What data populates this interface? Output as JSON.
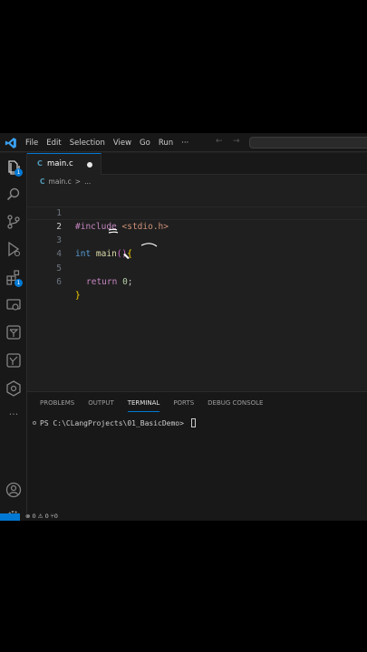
{
  "menu": [
    "File",
    "Edit",
    "Selection",
    "View",
    "Go",
    "Run",
    "···"
  ],
  "tabs": [
    {
      "icon": "C",
      "label": "main.c",
      "modified": true
    }
  ],
  "breadcrumb": {
    "icon": "C",
    "file": "main.c",
    "sep": ">",
    "more": "..."
  },
  "editor": {
    "lines": [
      {
        "num": "1"
      },
      {
        "num": "2"
      },
      {
        "num": "3"
      },
      {
        "num": "4"
      },
      {
        "num": "5"
      },
      {
        "num": "6"
      }
    ],
    "include_kw": "#include",
    "include_hdr": "<stdio.h>",
    "int_kw": "int",
    "main_fn": "main",
    "open_paren": "(",
    "close_paren": ")",
    "open_brace": "{",
    "return_kw": "return",
    "zero": "0",
    "semi": ";",
    "close_brace": "}"
  },
  "activity_badges": {
    "explorer": "1",
    "extensions": "1"
  },
  "panel": {
    "tabs": [
      "PROBLEMS",
      "OUTPUT",
      "TERMINAL",
      "PORTS",
      "DEBUG CONSOLE"
    ],
    "active_tab": "TERMINAL",
    "prompt": "PS C:\\CLangProjects\\01_BasicDemo> "
  },
  "status": {
    "text": "⊗ 0 ⚠ 0   ⑂0"
  },
  "colors": {
    "accent": "#0078d4",
    "background": "#1f1f1f",
    "sidebar": "#181818"
  },
  "icons": [
    "vscode-logo-icon",
    "explorer-icon",
    "search-icon",
    "source-control-icon",
    "run-debug-icon",
    "extensions-icon",
    "remote-explorer-icon",
    "testing-icon",
    "cmake-icon",
    "docker-icon",
    "more-icon",
    "account-icon",
    "settings-gear-icon"
  ]
}
